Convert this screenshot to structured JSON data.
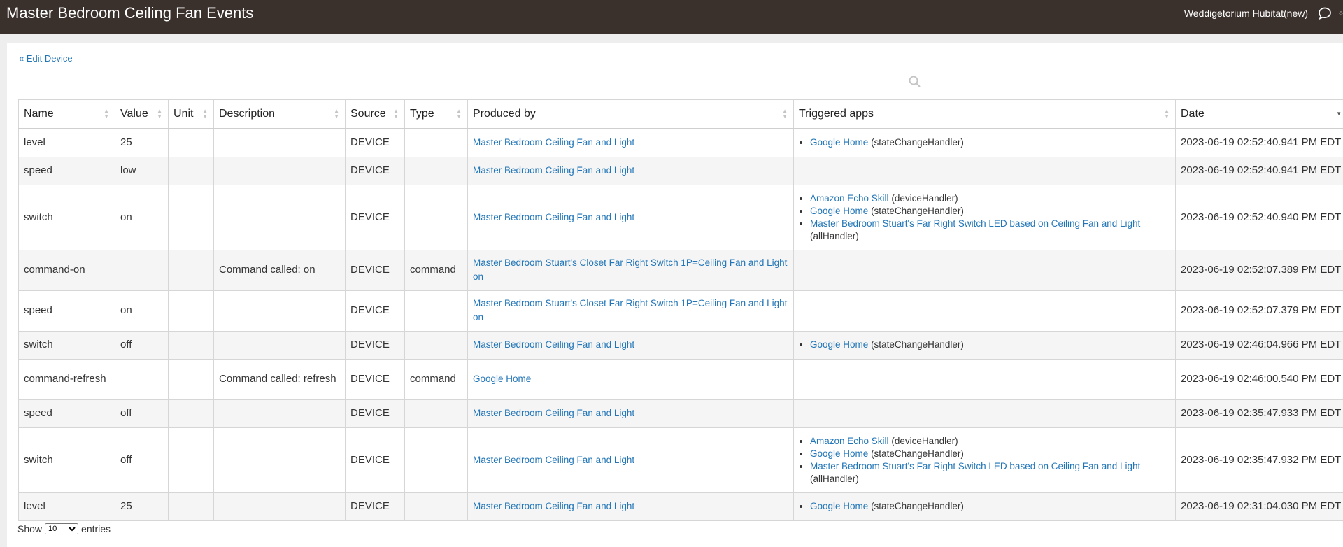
{
  "header": {
    "title": "Master Bedroom Ceiling Fan Events",
    "hub_name": "Weddigetorium Hubitat(new)"
  },
  "edit_link": "« Edit Device",
  "search": {
    "placeholder": "",
    "value": ""
  },
  "table": {
    "columns": [
      "Name",
      "Value",
      "Unit",
      "Description",
      "Source",
      "Type",
      "Produced by",
      "Triggered apps",
      "Date"
    ],
    "rows": [
      {
        "name": "level",
        "value": "25",
        "unit": "",
        "description": "",
        "source": "DEVICE",
        "type": "",
        "produced_by": "Master Bedroom Ceiling Fan and Light",
        "apps": [
          {
            "name": "Google Home",
            "handler": "(stateChangeHandler)"
          }
        ],
        "date": "2023-06-19 02:52:40.941 PM EDT"
      },
      {
        "name": "speed",
        "value": "low",
        "unit": "",
        "description": "",
        "source": "DEVICE",
        "type": "",
        "produced_by": "Master Bedroom Ceiling Fan and Light",
        "apps": [],
        "date": "2023-06-19 02:52:40.941 PM EDT"
      },
      {
        "name": "switch",
        "value": "on",
        "unit": "",
        "description": "",
        "source": "DEVICE",
        "type": "",
        "produced_by": "Master Bedroom Ceiling Fan and Light",
        "apps": [
          {
            "name": "Amazon Echo Skill",
            "handler": "(deviceHandler)"
          },
          {
            "name": "Google Home",
            "handler": "(stateChangeHandler)"
          },
          {
            "name": "Master Bedroom Stuart's Far Right Switch LED based on Ceiling Fan and Light",
            "handler": "(allHandler)"
          }
        ],
        "date": "2023-06-19 02:52:40.940 PM EDT"
      },
      {
        "name": "command-on",
        "value": "",
        "unit": "",
        "description": "Command called: on",
        "source": "DEVICE",
        "type": "command",
        "produced_by": "Master Bedroom Stuart's Closet Far Right Switch 1P=Ceiling Fan and Light on",
        "apps": [],
        "date": "2023-06-19 02:52:07.389 PM EDT"
      },
      {
        "name": "speed",
        "value": "on",
        "unit": "",
        "description": "",
        "source": "DEVICE",
        "type": "",
        "produced_by": "Master Bedroom Stuart's Closet Far Right Switch 1P=Ceiling Fan and Light on",
        "apps": [],
        "date": "2023-06-19 02:52:07.379 PM EDT"
      },
      {
        "name": "switch",
        "value": "off",
        "unit": "",
        "description": "",
        "source": "DEVICE",
        "type": "",
        "produced_by": "Master Bedroom Ceiling Fan and Light",
        "apps": [
          {
            "name": "Google Home",
            "handler": "(stateChangeHandler)"
          }
        ],
        "date": "2023-06-19 02:46:04.966 PM EDT"
      },
      {
        "name": "command-refresh",
        "value": "",
        "unit": "",
        "description": "Command called: refresh",
        "source": "DEVICE",
        "type": "command",
        "produced_by": "Google Home",
        "apps": [],
        "date": "2023-06-19 02:46:00.540 PM EDT"
      },
      {
        "name": "speed",
        "value": "off",
        "unit": "",
        "description": "",
        "source": "DEVICE",
        "type": "",
        "produced_by": "Master Bedroom Ceiling Fan and Light",
        "apps": [],
        "date": "2023-06-19 02:35:47.933 PM EDT"
      },
      {
        "name": "switch",
        "value": "off",
        "unit": "",
        "description": "",
        "source": "DEVICE",
        "type": "",
        "produced_by": "Master Bedroom Ceiling Fan and Light",
        "apps": [
          {
            "name": "Amazon Echo Skill",
            "handler": "(deviceHandler)"
          },
          {
            "name": "Google Home",
            "handler": "(stateChangeHandler)"
          },
          {
            "name": "Master Bedroom Stuart's Far Right Switch LED based on Ceiling Fan and Light",
            "handler": "(allHandler)"
          }
        ],
        "date": "2023-06-19 02:35:47.932 PM EDT"
      },
      {
        "name": "level",
        "value": "25",
        "unit": "",
        "description": "",
        "source": "DEVICE",
        "type": "",
        "produced_by": "Master Bedroom Ceiling Fan and Light",
        "apps": [
          {
            "name": "Google Home",
            "handler": "(stateChangeHandler)"
          }
        ],
        "date": "2023-06-19 02:31:04.030 PM EDT"
      }
    ]
  },
  "footer": {
    "show_label": "Show",
    "page_length": "10",
    "entries_label": "entries"
  }
}
